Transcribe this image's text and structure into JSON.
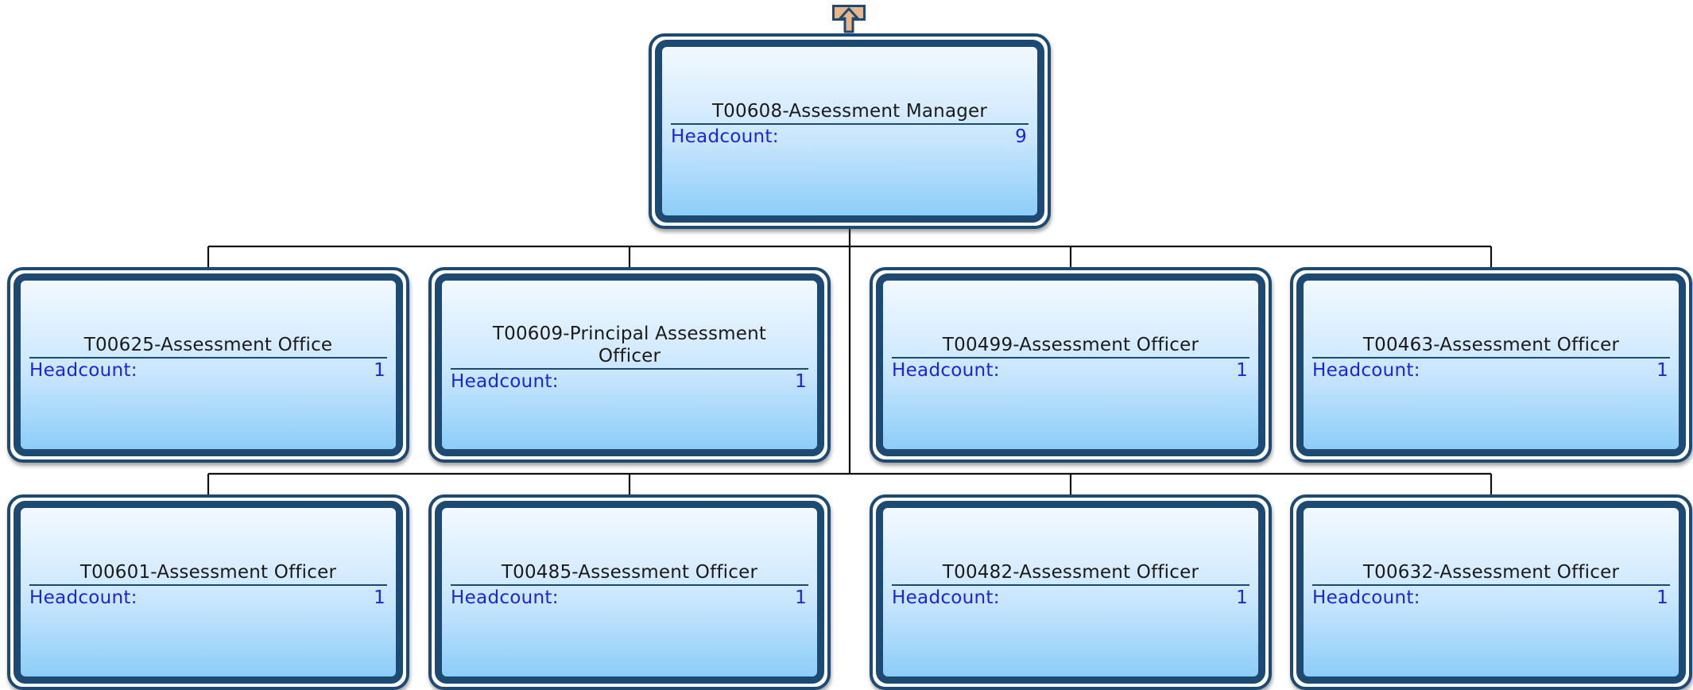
{
  "navigation": {
    "up_icon": "arrow-up-icon",
    "up_fill": "#e8b48a",
    "up_stroke": "#1d4a72"
  },
  "colors": {
    "frame": "#1d4a72",
    "gradient_top": "#f2f9ff",
    "gradient_bottom": "#8ccdf8",
    "headcount_text": "#1a26d9",
    "title_text": "#1a1a1a"
  },
  "root": {
    "title": "T00608-Assessment Manager",
    "headcount_label": "Headcount:",
    "headcount_value": "9"
  },
  "children": [
    {
      "title": "T00625-Assessment Office",
      "headcount_label": "Headcount:",
      "headcount_value": "1"
    },
    {
      "title": "T00609-Principal Assessment Officer",
      "headcount_label": "Headcount:",
      "headcount_value": "1"
    },
    {
      "title": "T00499-Assessment Officer",
      "headcount_label": "Headcount:",
      "headcount_value": "1"
    },
    {
      "title": "T00463-Assessment Officer",
      "headcount_label": "Headcount:",
      "headcount_value": "1"
    },
    {
      "title": "T00601-Assessment Officer",
      "headcount_label": "Headcount:",
      "headcount_value": "1"
    },
    {
      "title": "T00485-Assessment Officer",
      "headcount_label": "Headcount:",
      "headcount_value": "1"
    },
    {
      "title": "T00482-Assessment Officer",
      "headcount_label": "Headcount:",
      "headcount_value": "1"
    },
    {
      "title": "T00632-Assessment Officer",
      "headcount_label": "Headcount:",
      "headcount_value": "1"
    }
  ]
}
